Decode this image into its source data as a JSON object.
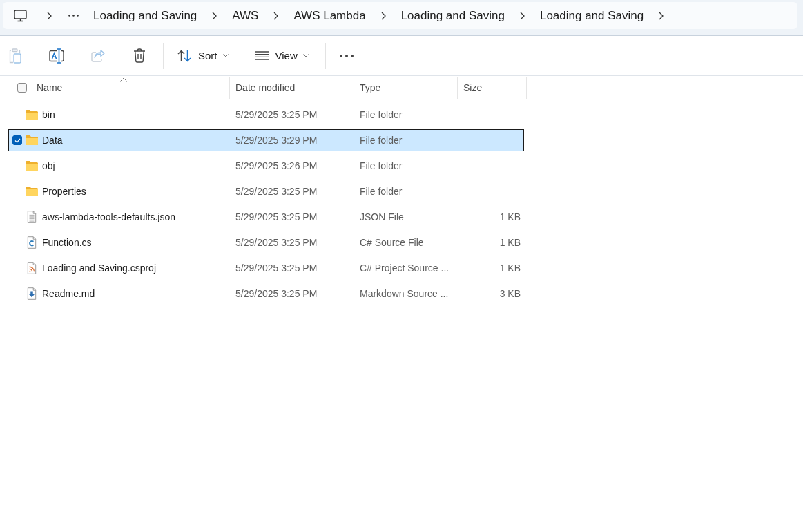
{
  "address_bar": {
    "items": [
      "Loading and Saving",
      "AWS",
      "AWS Lambda",
      "Loading and Saving",
      "Loading and Saving"
    ]
  },
  "toolbar": {
    "groups": [
      [
        {
          "kind": "paste",
          "disabled": true
        },
        {
          "kind": "rename",
          "disabled": false
        },
        {
          "kind": "share",
          "disabled": true
        },
        {
          "kind": "delete",
          "disabled": false
        }
      ],
      [
        {
          "kind": "sort",
          "label": "Sort",
          "disabled": false
        },
        {
          "kind": "view",
          "label": "View",
          "disabled": false
        }
      ],
      [
        {
          "kind": "more",
          "disabled": false
        }
      ]
    ]
  },
  "table": {
    "select_all": {
      "checked": false
    },
    "columns": [
      {
        "label": "Name",
        "sorted": true
      },
      {
        "label": "Date modified",
        "sorted": false
      },
      {
        "label": "Type",
        "sorted": false
      },
      {
        "label": "Size",
        "sorted": false
      }
    ],
    "rows": [
      {
        "kind": "folder",
        "name": "bin",
        "date": "5/29/2025 3:25 PM",
        "type": "File folder",
        "selected": false
      },
      {
        "kind": "folder",
        "name": "Data",
        "date": "5/29/2025 3:29 PM",
        "type": "File folder",
        "selected": true
      },
      {
        "kind": "folder",
        "name": "obj",
        "date": "5/29/2025 3:26 PM",
        "type": "File folder",
        "selected": false
      },
      {
        "kind": "folder",
        "name": "Properties",
        "date": "5/29/2025 3:25 PM",
        "type": "File folder",
        "selected": false
      },
      {
        "kind": "document",
        "name": "aws-lambda-tools-defaults.json",
        "date": "5/29/2025 3:25 PM",
        "type": "JSON File",
        "size": "1 KB",
        "selected": false
      },
      {
        "kind": "csharp",
        "name": "Function.cs",
        "date": "5/29/2025 3:25 PM",
        "type": "C# Source File",
        "size": "1 KB",
        "selected": false
      },
      {
        "kind": "project",
        "name": "Loading and Saving.csproj",
        "date": "5/29/2025 3:25 PM",
        "type": "C# Project Source ...",
        "size": "1 KB",
        "selected": false
      },
      {
        "kind": "markdown",
        "name": "Readme.md",
        "date": "5/29/2025 3:25 PM",
        "type": "Markdown Source ...",
        "size": "3 KB",
        "selected": false
      }
    ]
  }
}
